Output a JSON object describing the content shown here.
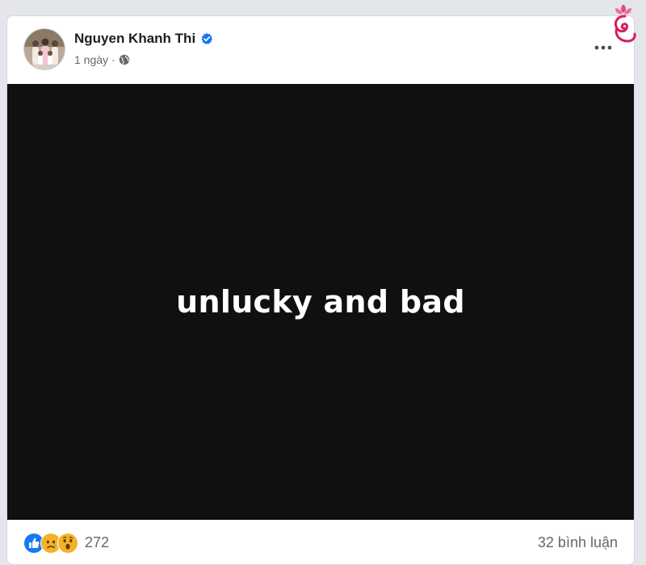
{
  "post": {
    "author": "Nguyen Khanh Thi",
    "time": "1 ngày",
    "separator": "·",
    "image_text": "unlucky and bad",
    "reaction_count": "272",
    "comment_count": "32 bình luận"
  },
  "icons": {
    "verified": "verified-badge-icon",
    "privacy": "globe-icon",
    "more": "more-options-icon",
    "reactions": [
      "like-reaction-icon",
      "sad-reaction-icon",
      "wow-reaction-icon"
    ]
  },
  "colors": {
    "verified": "#1877f2",
    "like": "#1877f2",
    "reaction_emoji": "#f7b125",
    "image_bg": "#101010",
    "logo": "#d81b60"
  }
}
